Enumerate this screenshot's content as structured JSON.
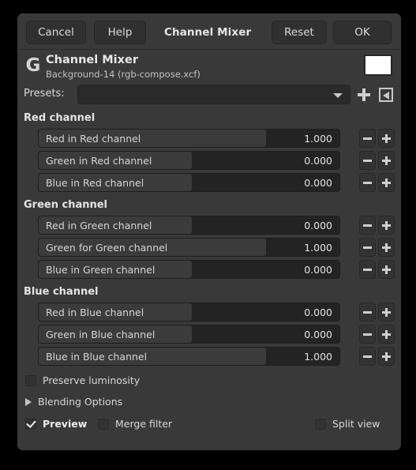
{
  "window": {
    "title": "Channel Mixer"
  },
  "toolbar": {
    "cancel_label": "Cancel",
    "help_label": "Help",
    "title_label": "Channel Mixer",
    "reset_label": "Reset",
    "ok_label": "OK"
  },
  "header": {
    "logo": "G",
    "title": "Channel Mixer",
    "subtitle": "Background-14 (rgb-compose.xcf)",
    "swatch_color": "#ffffff"
  },
  "presets": {
    "label": "Presets:",
    "value": "",
    "add_icon": "plus-icon",
    "menu_icon": "preset-menu-icon"
  },
  "sections": [
    {
      "title": "Red channel",
      "rows": [
        {
          "label": "Red in Red channel",
          "value": "1.000",
          "fill_pct": 75.5
        },
        {
          "label": "Green in Red channel",
          "value": "0.000",
          "fill_pct": 51.0
        },
        {
          "label": "Blue in Red channel",
          "value": "0.000",
          "fill_pct": 51.0
        }
      ]
    },
    {
      "title": "Green channel",
      "rows": [
        {
          "label": "Red in Green channel",
          "value": "0.000",
          "fill_pct": 51.0
        },
        {
          "label": "Green for Green channel",
          "value": "1.000",
          "fill_pct": 75.5
        },
        {
          "label": "Blue in Green channel",
          "value": "0.000",
          "fill_pct": 51.0
        }
      ]
    },
    {
      "title": "Blue channel",
      "rows": [
        {
          "label": "Red in Blue channel",
          "value": "0.000",
          "fill_pct": 51.0
        },
        {
          "label": "Green in Blue channel",
          "value": "0.000",
          "fill_pct": 51.0
        },
        {
          "label": "Blue in Blue channel",
          "value": "1.000",
          "fill_pct": 75.5
        }
      ]
    }
  ],
  "options": {
    "preserve_luminosity": {
      "label": "Preserve luminosity",
      "checked": false
    },
    "blending_options": {
      "label": "Blending Options",
      "expanded": false
    },
    "preview": {
      "label": "Preview",
      "checked": true
    },
    "merge_filter": {
      "label": "Merge filter",
      "checked": false
    },
    "split_view": {
      "label": "Split view",
      "checked": false
    }
  }
}
